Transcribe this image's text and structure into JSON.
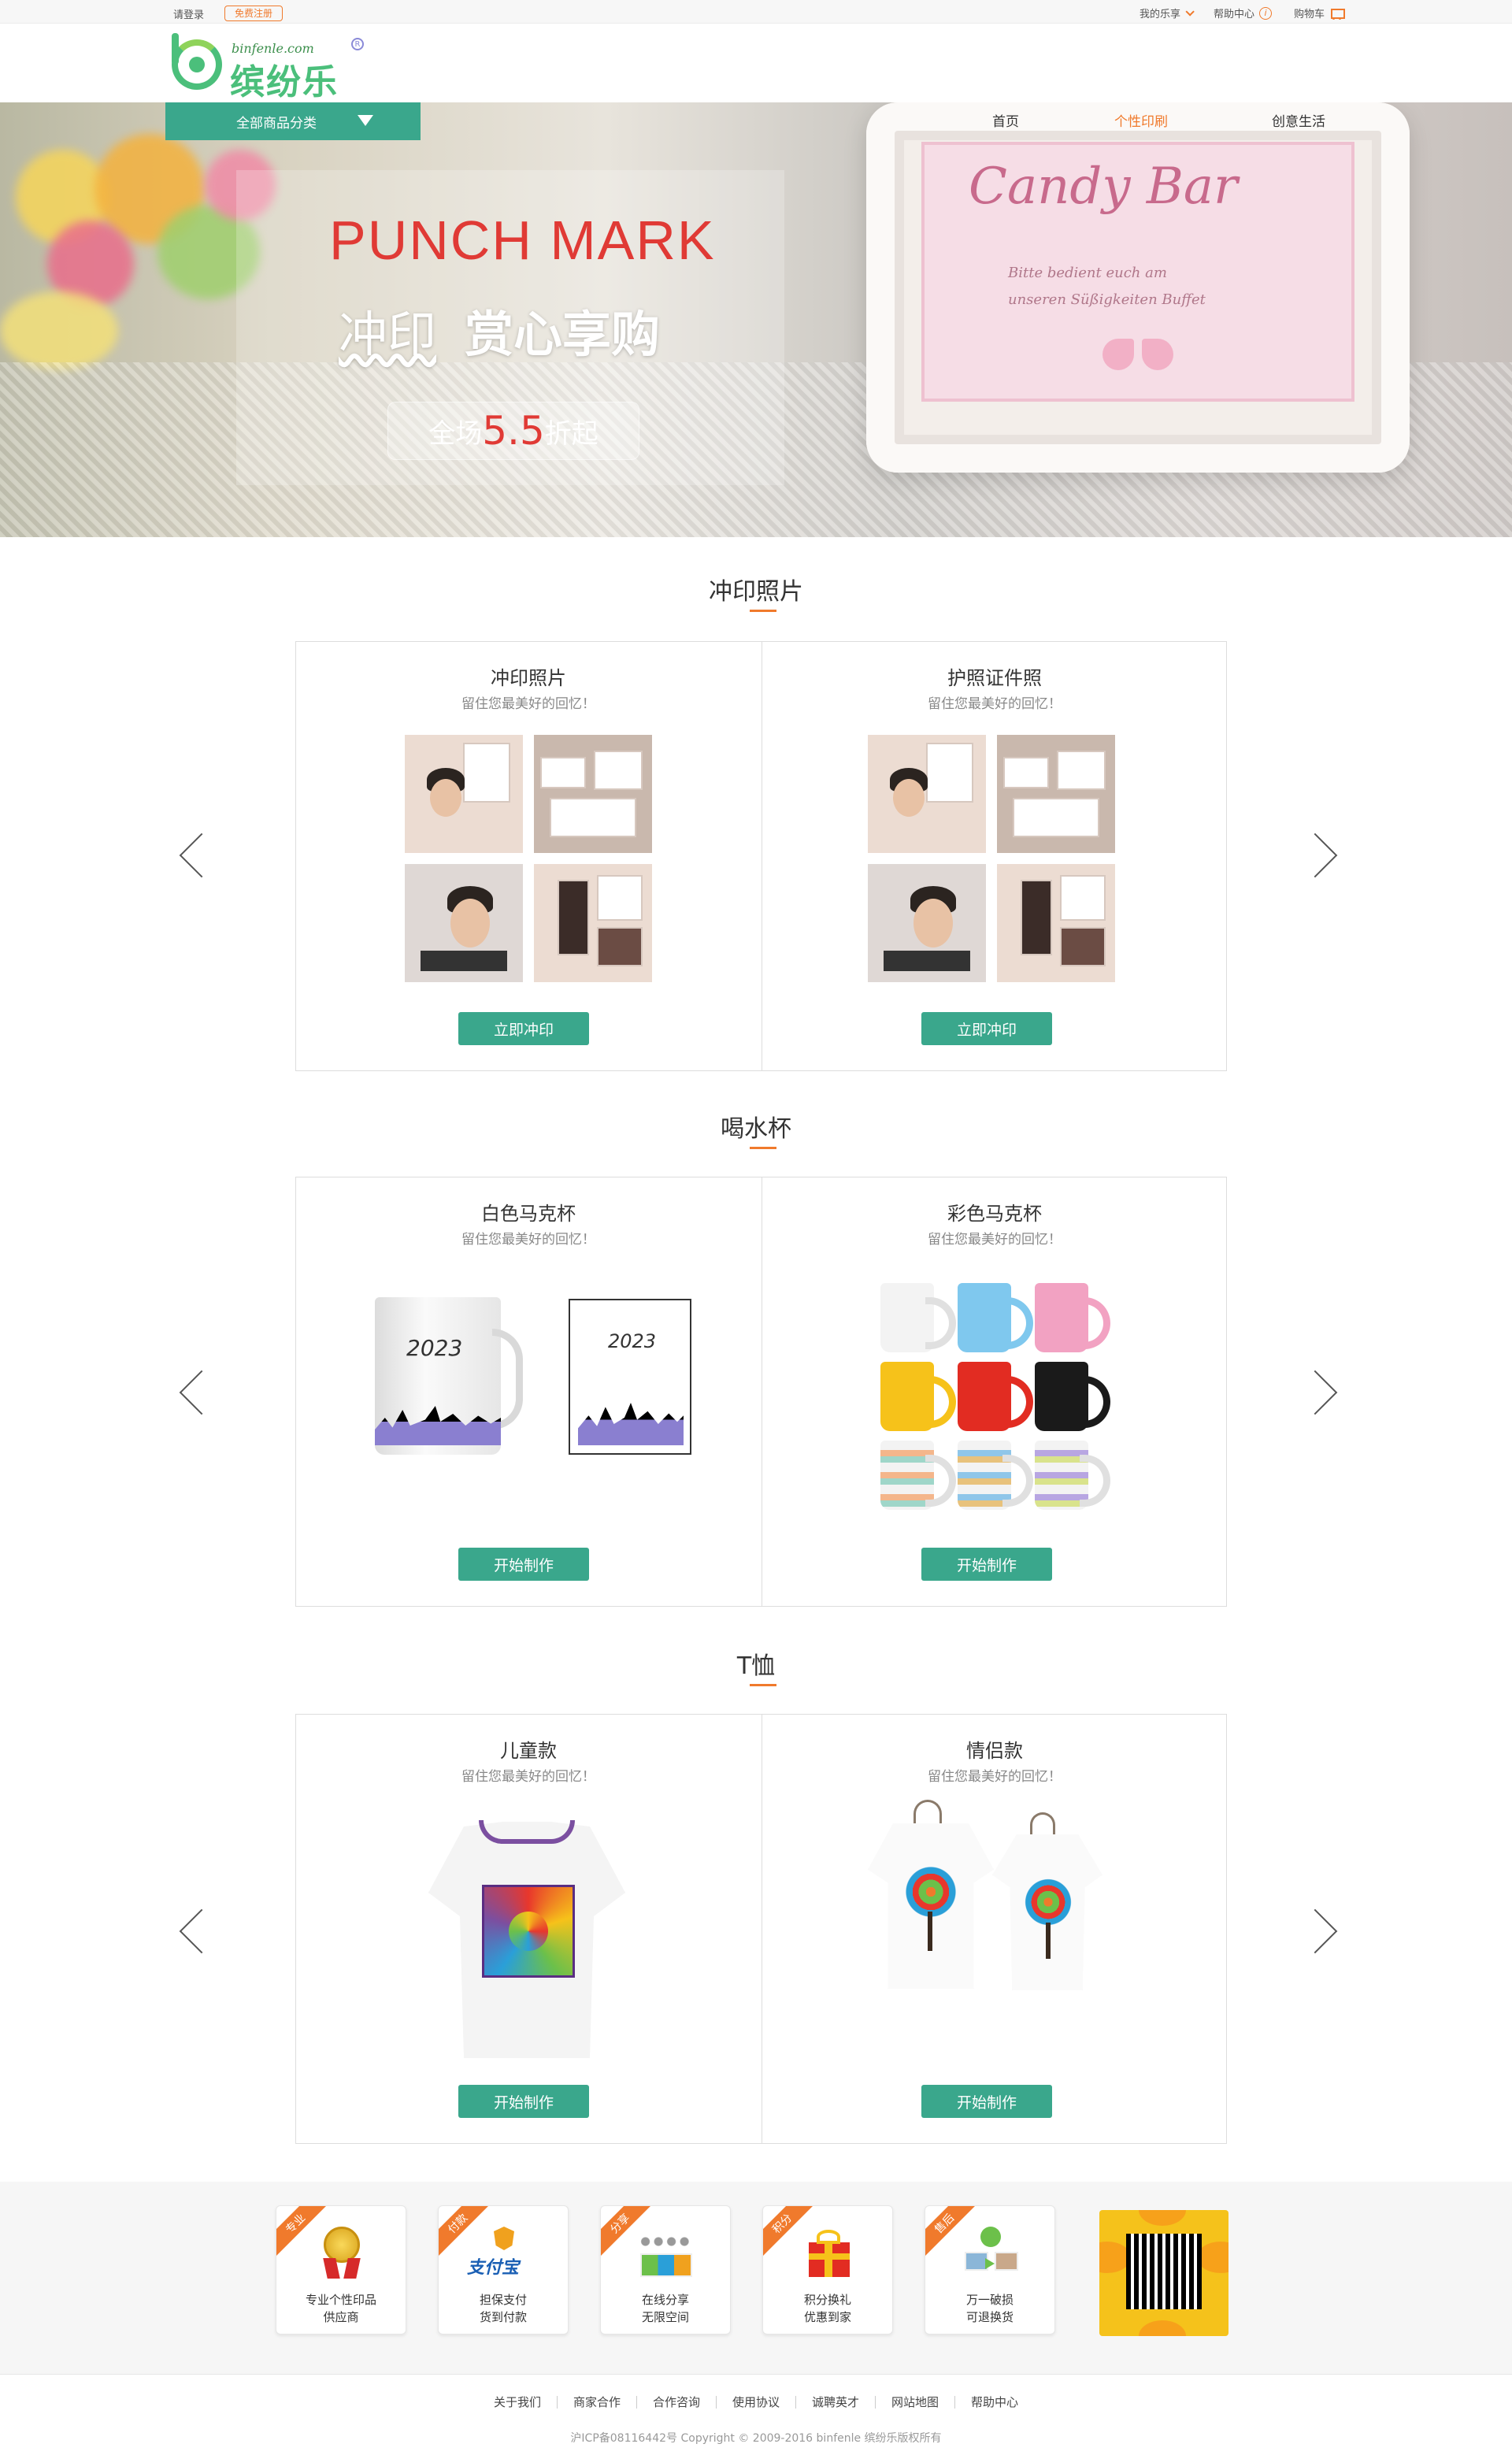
{
  "topbar": {
    "login": "请登录",
    "register": "免费注册",
    "my_account": "我的乐享",
    "help": "帮助中心",
    "cart": "购物车"
  },
  "logo": {
    "url": "binfenle.com",
    "cn": "缤纷乐"
  },
  "nav": {
    "category": "全部商品分类",
    "items": [
      "首页",
      "个性印刷",
      "创意生活"
    ],
    "active_index": 1
  },
  "banner": {
    "title": "PUNCH  MARK",
    "sub_a": "冲印",
    "sub_b": "赏心享购",
    "promo_prefix": "全场",
    "promo_value": "5.5",
    "promo_suffix": "折起",
    "frame_script": "Candy Bar",
    "frame_small_1": "Bitte bedient euch am",
    "frame_small_2": "unseren Süßigkeiten Buffet"
  },
  "sections": [
    {
      "title": "冲印照片",
      "items": [
        {
          "title": "冲印照片",
          "sub": "留住您最美好的回忆！",
          "button": "立即冲印"
        },
        {
          "title": "护照证件照",
          "sub": "留住您最美好的回忆！",
          "button": "立即冲印"
        }
      ]
    },
    {
      "title": "喝水杯",
      "items": [
        {
          "title": "白色马克杯",
          "sub": "留住您最美好的回忆！",
          "button": "开始制作"
        },
        {
          "title": "彩色马克杯",
          "sub": "留住您最美好的回忆！",
          "button": "开始制作"
        }
      ]
    },
    {
      "title": "T恤",
      "items": [
        {
          "title": "儿童款",
          "sub": "留住您最美好的回忆！",
          "button": "开始制作"
        },
        {
          "title": "情侣款",
          "sub": "留住您最美好的回忆！",
          "button": "开始制作"
        }
      ]
    }
  ],
  "mug_image_text": "2023",
  "features": [
    {
      "ribbon": "专业",
      "line1": "专业个性印品",
      "line2": "供应商",
      "icon": "medal-icon"
    },
    {
      "ribbon": "付款",
      "line1": "担保支付",
      "line2": "货到付款",
      "icon": "alipay-icon"
    },
    {
      "ribbon": "分享",
      "line1": "在线分享",
      "line2": "无限空间",
      "icon": "share-people-icon"
    },
    {
      "ribbon": "积分",
      "line1": "积分换礼",
      "line2": "优惠到家",
      "icon": "gift-icon"
    },
    {
      "ribbon": "售后",
      "line1": "万一破损",
      "line2": "可退换货",
      "icon": "return-icon"
    }
  ],
  "footer": {
    "links": [
      "关于我们",
      "商家合作",
      "合作咨询",
      "使用协议",
      "诚聘英才",
      "网站地图",
      "帮助中心"
    ],
    "copyright": "沪ICP备08116442号 Copyright © 2009-2016 binfenle 缤纷乐版权所有"
  },
  "colors": {
    "accent_green": "#3aa78c",
    "accent_orange": "#f07a2c",
    "promo_red": "#e03a35"
  }
}
